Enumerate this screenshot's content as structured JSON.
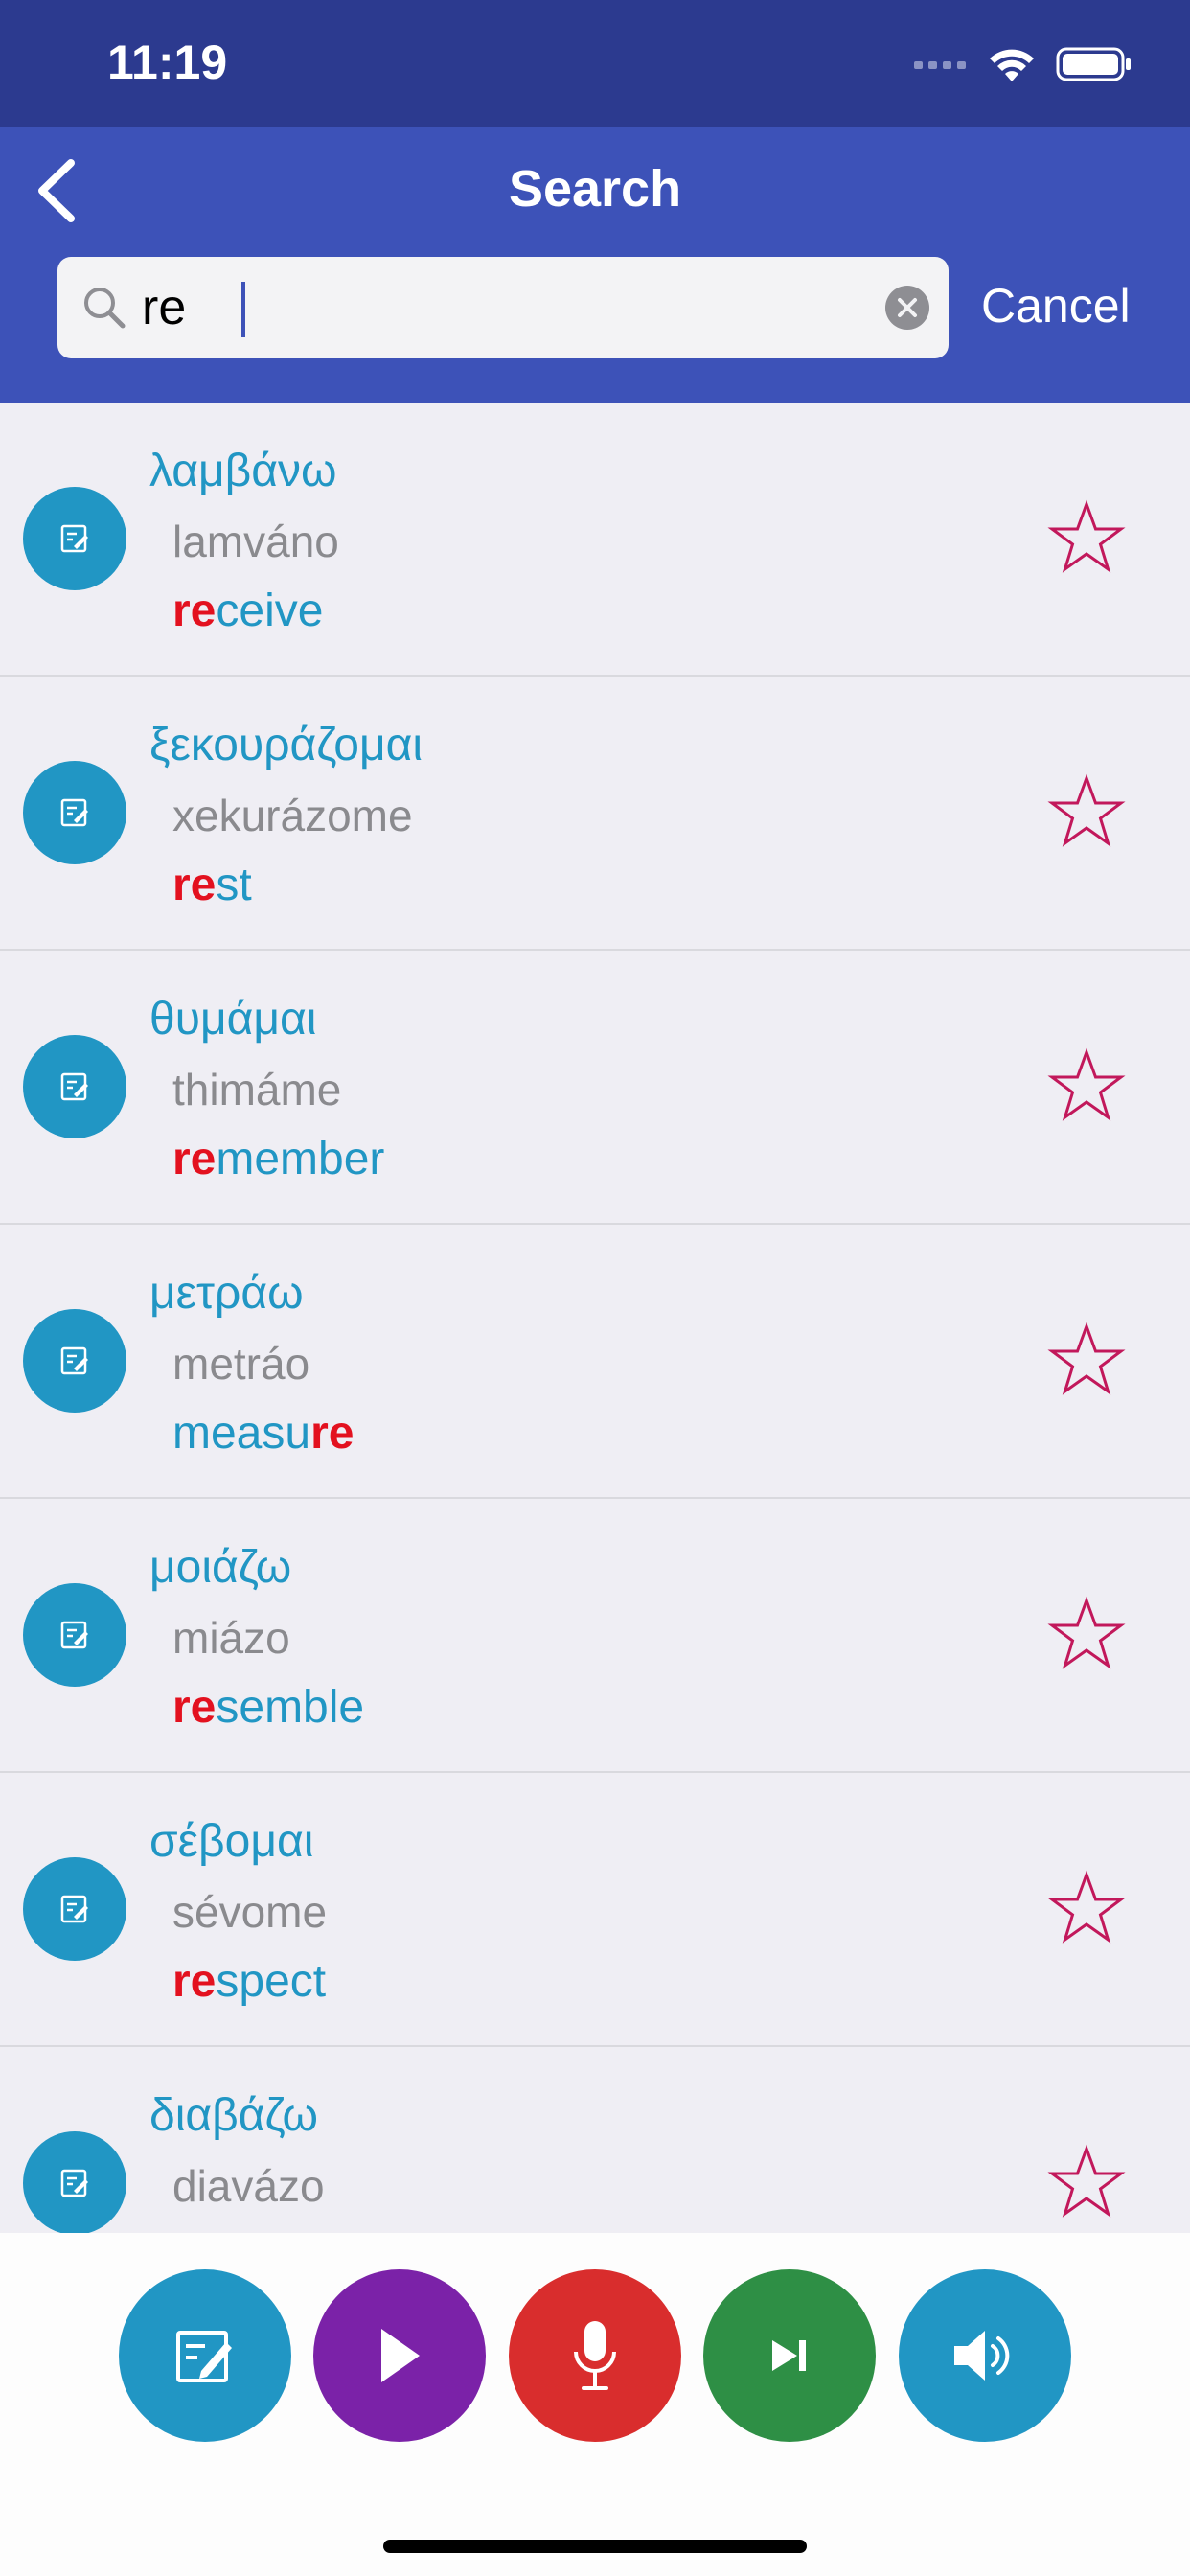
{
  "status_bar": {
    "time": "11:19"
  },
  "header": {
    "title": "Search",
    "cancel_label": "Cancel"
  },
  "search": {
    "value": "re",
    "placeholder": ""
  },
  "results": [
    {
      "greek": "λαμβάνω",
      "translit": "lamváno",
      "english_pre": "",
      "english_hl": "re",
      "english_post": "ceive"
    },
    {
      "greek": "ξεκουράζομαι",
      "translit": "xekurázome",
      "english_pre": "",
      "english_hl": "re",
      "english_post": "st"
    },
    {
      "greek": "θυμάμαι",
      "translit": "thimáme",
      "english_pre": "",
      "english_hl": "re",
      "english_post": "member"
    },
    {
      "greek": "μετράω",
      "translit": "metráo",
      "english_pre": "measu",
      "english_hl": "re",
      "english_post": ""
    },
    {
      "greek": "μοιάζω",
      "translit": "miázo",
      "english_pre": "",
      "english_hl": "re",
      "english_post": "semble"
    },
    {
      "greek": "σέβομαι",
      "translit": "sévome",
      "english_pre": "",
      "english_hl": "re",
      "english_post": "spect"
    },
    {
      "greek": "διαβάζω",
      "translit": "diavázo",
      "english_pre": "",
      "english_hl": "",
      "english_post": ""
    }
  ],
  "toolbar": {
    "buttons": [
      {
        "icon": "edit-note-icon",
        "color": "#2196c4"
      },
      {
        "icon": "play-icon",
        "color": "#7b22a8"
      },
      {
        "icon": "microphone-icon",
        "color": "#d92d2d"
      },
      {
        "icon": "skip-next-icon",
        "color": "#2e8f45"
      },
      {
        "icon": "speaker-icon",
        "color": "#2196c4"
      }
    ]
  },
  "colors": {
    "status_bar": "#2c3a8f",
    "header": "#3d52b8",
    "accent_blue": "#2196c4",
    "highlight_red": "#e3111f",
    "star": "#c2185b"
  }
}
